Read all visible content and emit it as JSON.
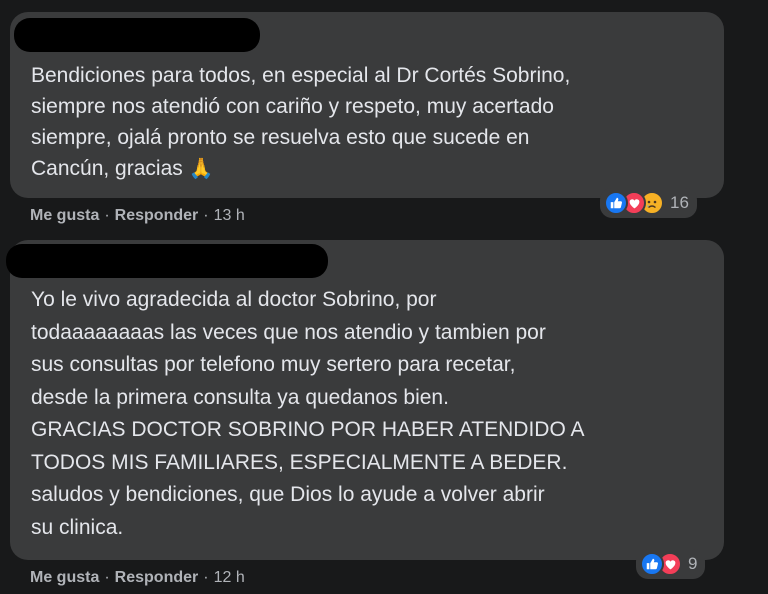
{
  "comments": [
    {
      "text": "Bendiciones para todos, en especial al Dr Cortés Sobrino,\nsiempre nos atendió con cariño y respeto, muy acertado\nsiempre, ojalá pronto se resuelva esto que sucede en\nCancún, gracias",
      "emoji": "🙏",
      "reactions": [
        "like-icon",
        "love-icon",
        "sad-icon"
      ],
      "reaction_count": "16",
      "like_label": "Me gusta",
      "reply_label": "Responder",
      "time": "13 h"
    },
    {
      "text": "Yo le vivo agradecida al doctor Sobrino, por\ntodaaaaaaaas las veces que nos atendio y tambien por\nsus consultas por telefono muy sertero para recetar,\ndesde la primera consulta ya quedanos bien.\nGRACIAS DOCTOR SOBRINO POR HABER ATENDIDO A\nTODOS MIS FAMILIARES, ESPECIALMENTE A BEDER.\nsaludos y bendiciones, que Dios lo ayude a volver abrir\nsu clinica.",
      "reactions": [
        "like-icon",
        "love-icon"
      ],
      "reaction_count": "9",
      "like_label": "Me gusta",
      "reply_label": "Responder",
      "time": "12 h"
    }
  ],
  "separator": "·",
  "colors": {
    "background": "#18191a",
    "bubble": "#3a3b3c",
    "text": "#e4e6eb",
    "secondary_text": "#b0b3b8",
    "like": "#1877f2",
    "love": "#f33e58",
    "sad": "#f7b125"
  }
}
